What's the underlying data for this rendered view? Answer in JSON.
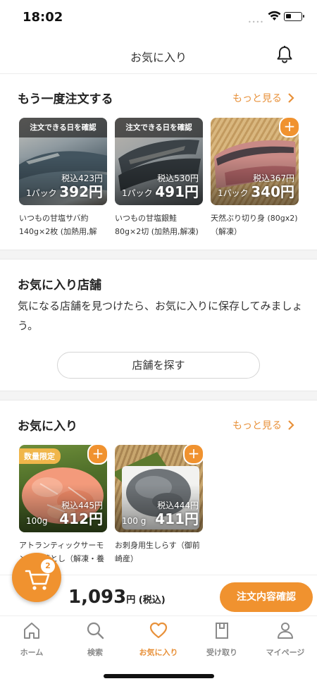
{
  "status_bar": {
    "time": "18:02",
    "signal": "••••"
  },
  "header": {
    "title": "お気に入り"
  },
  "reorder": {
    "title": "もう一度注文する",
    "more": "もっと見る",
    "items": [
      {
        "badge": "注文できる日を確認",
        "orig_price": "税込423円",
        "unit": "1パック",
        "price": "392円",
        "name": "いつもの甘塩サバ約140g×2枚 (加熱用,解"
      },
      {
        "badge": "注文できる日を確認",
        "orig_price": "税込530円",
        "unit": "1パック",
        "price": "491円",
        "name": "いつもの甘塩銀鮭 80g×2切 (加熱用,解凍)"
      },
      {
        "badge": "",
        "plus": "+",
        "orig_price": "税込367円",
        "unit": "1パック",
        "price": "340円",
        "name": "天然ぶり切り身 (80gx2)（解凍）"
      }
    ]
  },
  "fav_shops": {
    "title": "お気に入り店舗",
    "text": "気になる店舗を見つけたら、お気に入りに保存してみましょう。",
    "button": "店舗を探す"
  },
  "favorites": {
    "title": "お気に入り",
    "more": "もっと見る",
    "items": [
      {
        "limited": "数量限定",
        "plus": "+",
        "orig_price": "税込445円",
        "unit": "100g",
        "price": "412円",
        "name": "アトランティックサーモン切り落とし（解凍・養"
      },
      {
        "plus": "+",
        "orig_price": "税込444円",
        "unit": "100 g",
        "price": "411円",
        "name": "お刺身用生しらす（御前崎産）"
      }
    ]
  },
  "cart": {
    "count": "2",
    "total": "1,093",
    "total_unit": "円 (税込)",
    "order_button": "注文内容確認"
  },
  "tabs": [
    {
      "label": "ホーム",
      "icon": "home-icon"
    },
    {
      "label": "検索",
      "icon": "search-icon"
    },
    {
      "label": "お気に入り",
      "icon": "heart-icon",
      "active": true
    },
    {
      "label": "受け取り",
      "icon": "pickup-icon"
    },
    {
      "label": "マイページ",
      "icon": "person-icon"
    }
  ],
  "colors": {
    "accent": "#f0922f",
    "accent_text": "#e8913a"
  }
}
